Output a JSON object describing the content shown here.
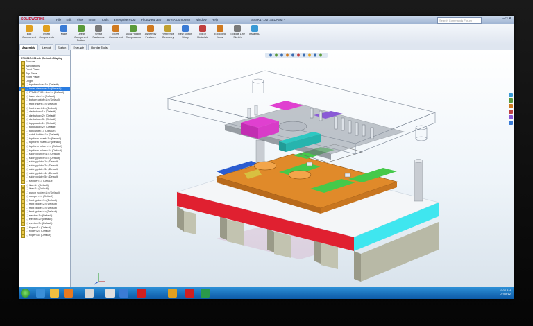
{
  "app": {
    "brand": "SOLIDWORKS",
    "document_title": "SSSK17.01n.SLDASM *"
  },
  "menu": [
    "File",
    "Edit",
    "View",
    "Insert",
    "Tools",
    "Enterprise PDM",
    "Photoview 360",
    "3DVIA Composer",
    "Window",
    "Help"
  ],
  "search": {
    "placeholder": "Search Commands Forum"
  },
  "ribbon": [
    {
      "label": "Edit Component",
      "color": "#e0a020"
    },
    {
      "label": "Insert Components",
      "color": "#e0a020"
    },
    {
      "label": "Mate",
      "color": "#3a7bd5"
    },
    {
      "label": "Linear Component Pattern",
      "color": "#5a9a3a"
    },
    {
      "label": "Smart Fasteners",
      "color": "#7a7a7a"
    },
    {
      "label": "Move Component",
      "color": "#d07a20"
    },
    {
      "label": "Show Hidden Components",
      "color": "#5a9a3a"
    },
    {
      "label": "Assembly Features",
      "color": "#d07a20"
    },
    {
      "label": "Reference Geometry",
      "color": "#c0a030"
    },
    {
      "label": "New Motion Study",
      "color": "#3a7bd5"
    },
    {
      "label": "Bill of Materials",
      "color": "#c04040"
    },
    {
      "label": "Exploded View",
      "color": "#d07a20"
    },
    {
      "label": "Explode Line Sketch",
      "color": "#7a7a7a"
    },
    {
      "label": "Instant3D",
      "color": "#3a9ad5"
    }
  ],
  "tabs": [
    "Assembly",
    "Layout",
    "Sketch",
    "Evaluate",
    "Render Tools"
  ],
  "tree": {
    "root": "PRM61F-001 slx (Default<Display",
    "items": [
      "Sensors",
      "Annotations",
      "Front Plane",
      "Top Plane",
      "Right Plane",
      "Origin",
      "(-) top die shoe<1> (Default)",
      "(-) lower die shoe<1> (Default)",
      "(-) PRM61F-001 slx<1> (Default)",
      "(-) lower die<1> (Default)",
      "(-) bottom cutoff<1> (Default)",
      "(-) front insert<1> (Default)",
      "(-) front insert<2> (Default)",
      "(-) die button<1> (Default)",
      "(-) die button<2> (Default)",
      "(-) die button<3> (Default)",
      "(-) top punch<1> (Default)",
      "(-) top punch<2> (Default)",
      "(-) top cutoff<1> (Default)",
      "(-) cutoff holder<1> (Default)",
      "(-) top form insert<1> (Default)",
      "(-) top form insert<2> (Default)",
      "(-) top form holder<1> (Default)",
      "(-) top form holder<2> (Default)",
      "(-) sliding punch<1> (Default)",
      "(-) sliding punch<2> (Default)",
      "(-) sliding plate<1> (Default)",
      "(-) sliding plate<2> (Default)",
      "(-) sliding plate<3> (Default)",
      "(-) sliding plate<4> (Default)",
      "(-) sliding plate<5> (Default)",
      "(-) stripper<1> (Default)",
      "(-) line<1> (Default)",
      "(-) line<2> (Default)",
      "(-) punch holder<1> (Default)",
      "(-) stopper<1> (Default)",
      "(-) front guide<1> (Default)",
      "(-) front guide<2> (Default)",
      "(-) front guide<3> (Default)",
      "(-) front guide<4> (Default)",
      "(-) ejector<1> (Default)",
      "(-) ejector<2> (Default)",
      "(-) ejector<3> (Default)",
      "(-) finger<1> (Default)",
      "(-) finger<2> (Default)",
      "(-) finger<3> (Default)"
    ],
    "selected_index": 7
  },
  "bottom_tabs": [
    "Model",
    "Motion Study 1"
  ],
  "status": {
    "left": "SolidWorks Premium 2011 x64 Edition",
    "right": "Under Defined",
    "extra": "IPS"
  },
  "taskbar": {
    "time": "9:02 AM",
    "date": "07/08/12"
  },
  "colors": {
    "red_band": "#e02030",
    "cyan_band": "#3fe6ef",
    "magenta": "#e040d0",
    "orange": "#e08a2a",
    "green": "#45c94a",
    "teal": "#2ec8c2",
    "purple": "#8a5ad6"
  }
}
